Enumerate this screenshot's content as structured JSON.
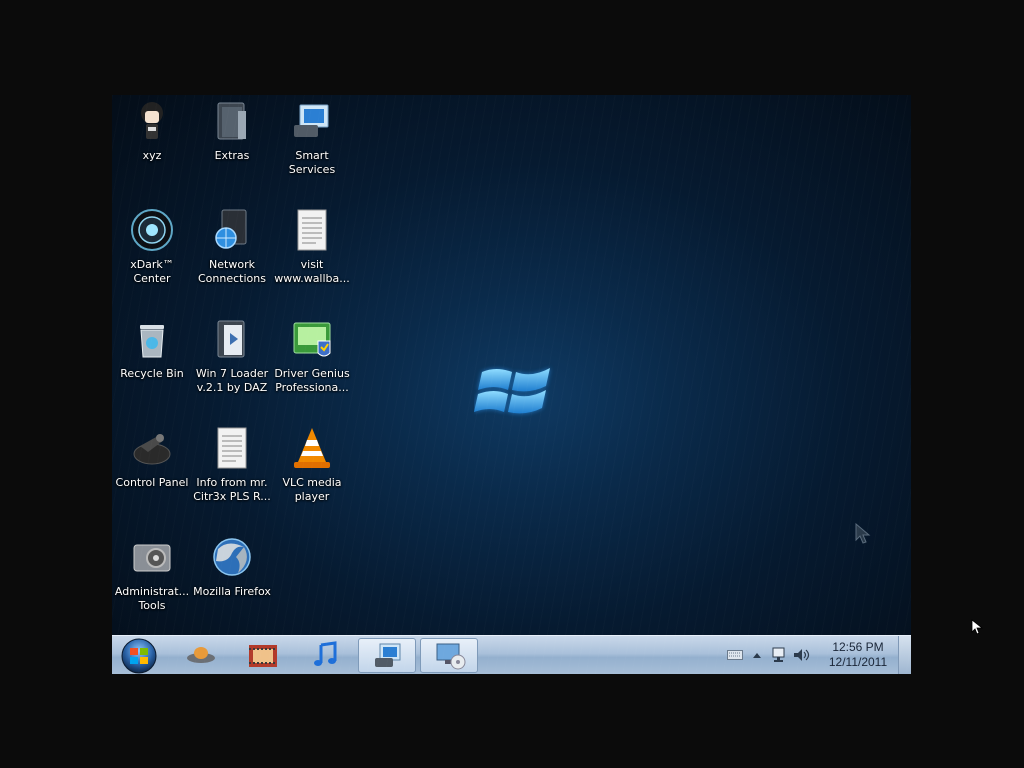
{
  "desktop": {
    "icons": [
      {
        "label": "xyz",
        "icon": "user-avatar-icon"
      },
      {
        "label": "Extras",
        "icon": "folder-icon"
      },
      {
        "label": "Smart Services",
        "icon": "smart-services-icon"
      },
      {
        "label": "xDark™ Center",
        "icon": "xdark-center-icon"
      },
      {
        "label": "Network Connections",
        "icon": "network-connections-icon"
      },
      {
        "label": "visit www.wallba...",
        "icon": "text-document-icon"
      },
      {
        "label": "Recycle Bin",
        "icon": "recycle-bin-icon"
      },
      {
        "label": "Win 7  Loader v.2.1 by DAZ",
        "icon": "folder-icon"
      },
      {
        "label": "Driver Genius Professiona...",
        "icon": "driver-genius-icon"
      },
      {
        "label": "Control Panel",
        "icon": "control-panel-icon"
      },
      {
        "label": "Info from mr. Citr3x PLS R...",
        "icon": "text-document-icon"
      },
      {
        "label": "VLC media player",
        "icon": "vlc-cone-icon"
      },
      {
        "label": "Administrat... Tools",
        "icon": "admin-tools-icon"
      },
      {
        "label": "Mozilla Firefox",
        "icon": "firefox-icon"
      }
    ]
  },
  "taskbar": {
    "pinned": [
      {
        "name": "xdark-launcher",
        "icon": "ufo-icon"
      },
      {
        "name": "media-library",
        "icon": "film-icon"
      },
      {
        "name": "music-player",
        "icon": "music-note-icon"
      },
      {
        "name": "smart-services",
        "icon": "smart-services-icon",
        "active": true
      },
      {
        "name": "display-settings",
        "icon": "monitor-cd-icon",
        "active": true
      }
    ],
    "tray": {
      "icons": [
        "keyboard-icon",
        "show-hidden-icons-arrow",
        "network-icon",
        "volume-icon"
      ]
    },
    "clock": {
      "time": "12:56 PM",
      "date": "12/11/2011"
    }
  },
  "colors": {
    "taskbar_top": "#c9d8ea",
    "taskbar_bottom": "#a8bfd8",
    "desktop_bg": "#0a2a4a",
    "logo_blue": "#4fb6f0"
  }
}
